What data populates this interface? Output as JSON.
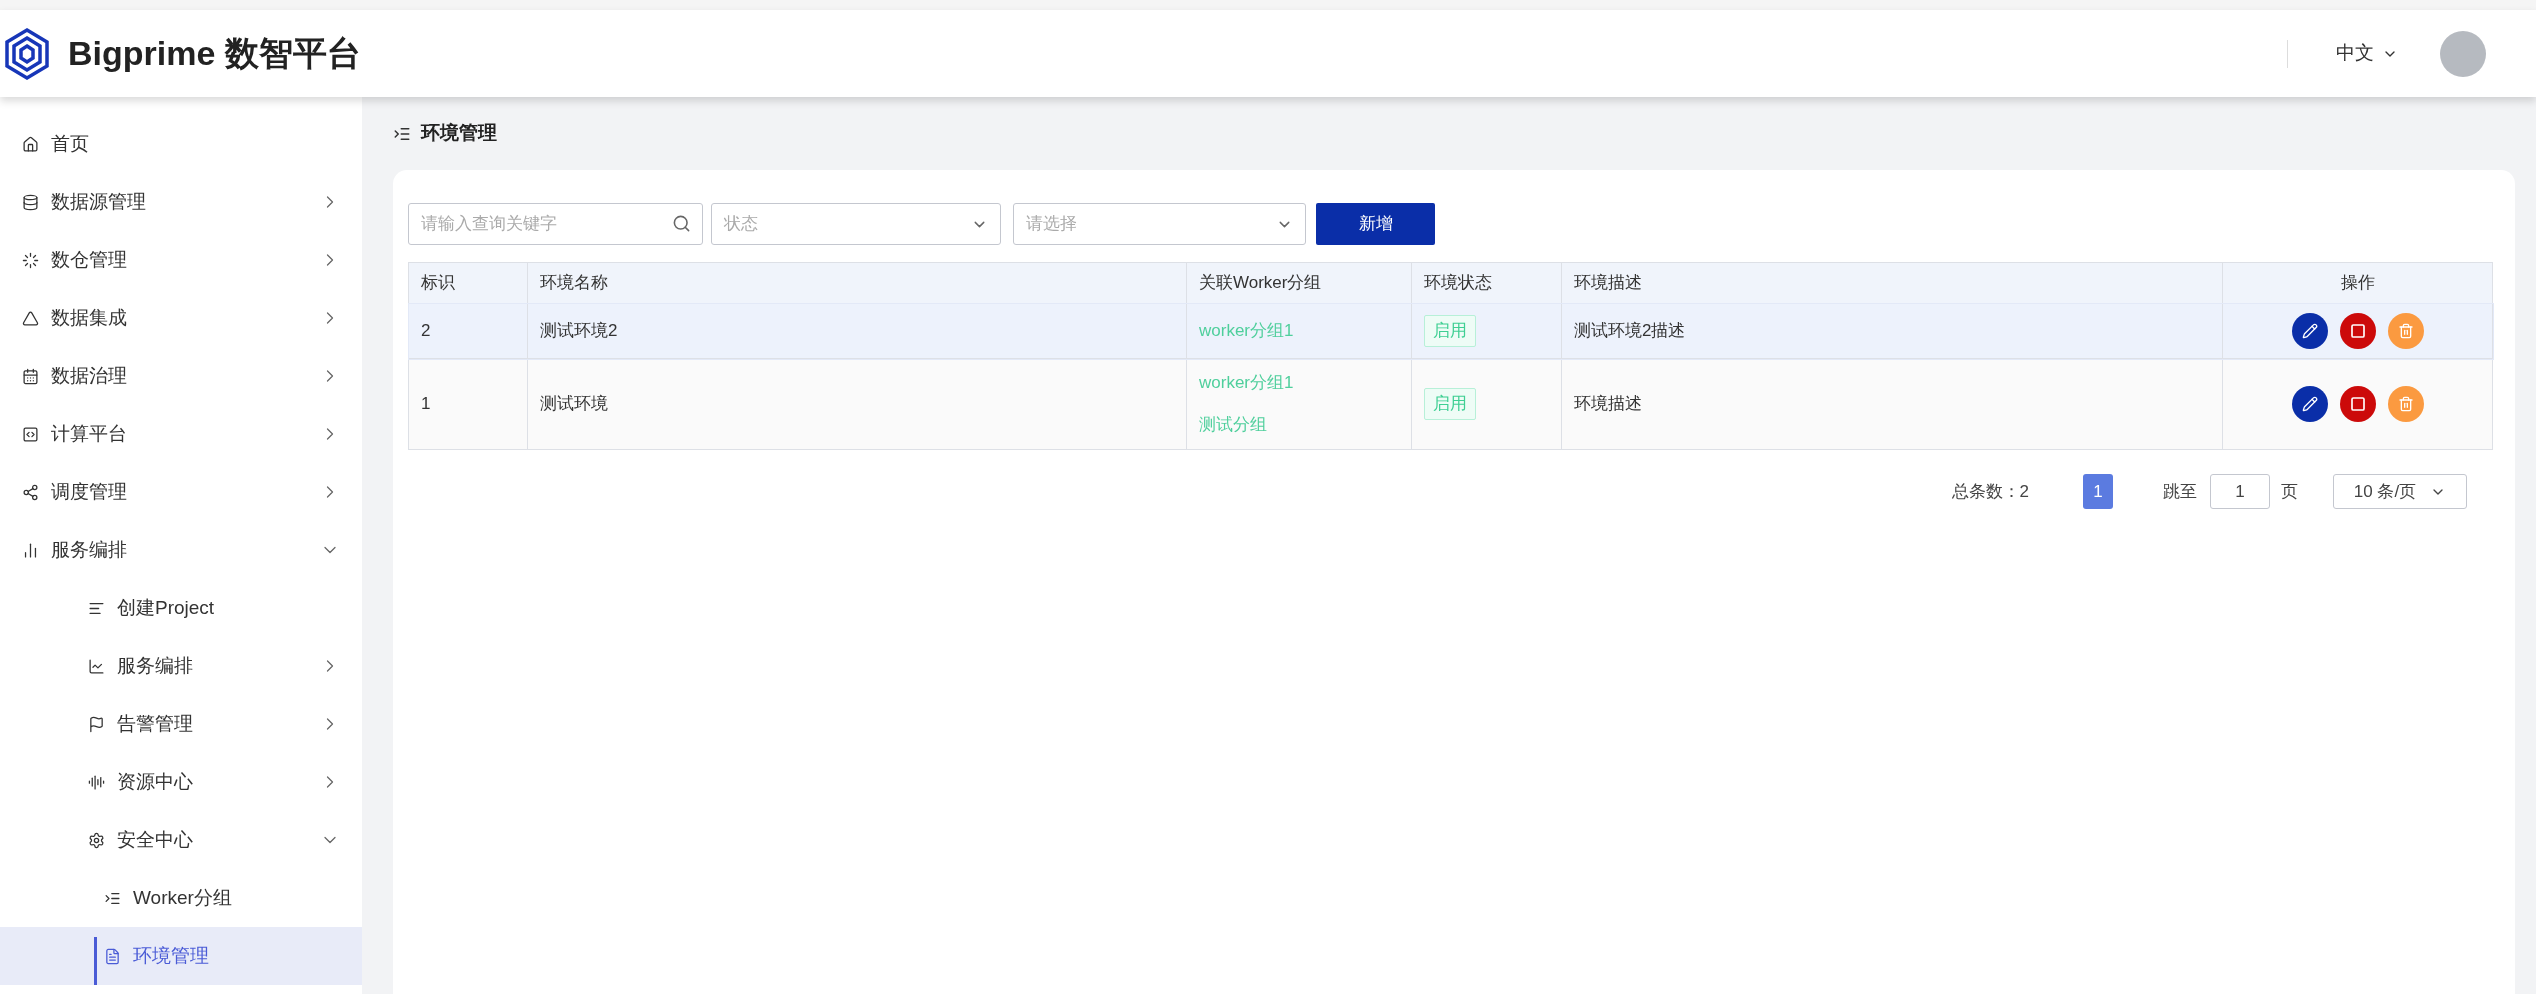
{
  "header": {
    "title": "Bigprime 数智平台",
    "language": "中文"
  },
  "sidebar": {
    "items": [
      {
        "label": "首页",
        "selected": false
      },
      {
        "label": "数据源管理",
        "selected": false,
        "expanded": false
      },
      {
        "label": "数仓管理",
        "selected": false,
        "expanded": false
      },
      {
        "label": "数据集成",
        "selected": false,
        "expanded": false
      },
      {
        "label": "数据治理",
        "selected": false,
        "expanded": false
      },
      {
        "label": "计算平台",
        "selected": false,
        "expanded": false
      },
      {
        "label": "调度管理",
        "selected": false,
        "expanded": false
      },
      {
        "label": "服务编排",
        "selected": false,
        "expanded": true,
        "children": [
          {
            "label": "创建Project",
            "selected": false
          },
          {
            "label": "服务编排",
            "selected": false,
            "expanded": false
          },
          {
            "label": "告警管理",
            "selected": false,
            "expanded": false
          },
          {
            "label": "资源中心",
            "selected": false,
            "expanded": false
          },
          {
            "label": "安全中心",
            "selected": false,
            "expanded": true,
            "children": [
              {
                "label": "Worker分组",
                "selected": false
              },
              {
                "label": "环境管理",
                "selected": true
              }
            ]
          }
        ]
      }
    ]
  },
  "page": {
    "title": "环境管理"
  },
  "toolbar": {
    "search": {
      "placeholder": "请输入查询关键字"
    },
    "status_select": {
      "placeholder": "状态"
    },
    "select": {
      "placeholder": "请选择"
    },
    "add_button": "新增"
  },
  "table": {
    "columns": [
      "标识",
      "环境名称",
      "关联Worker分组",
      "环境状态",
      "环境描述",
      "操作"
    ],
    "rows": [
      {
        "selected": true,
        "id": "2",
        "name": "测试环境2",
        "groups": [
          "worker分组1"
        ],
        "status": "启用",
        "description": "测试环境2描述"
      },
      {
        "selected": false,
        "id": "1",
        "name": "测试环境",
        "groups": [
          "worker分组1",
          "测试分组"
        ],
        "status": "启用",
        "description": "环境描述"
      }
    ]
  },
  "pagination": {
    "total": "总条数：2",
    "pages": [
      {
        "label": "1",
        "selected": true
      }
    ],
    "jump_label": "跳至",
    "jump_value": "1",
    "page_unit": "页",
    "page_size": "10 条/页"
  }
}
